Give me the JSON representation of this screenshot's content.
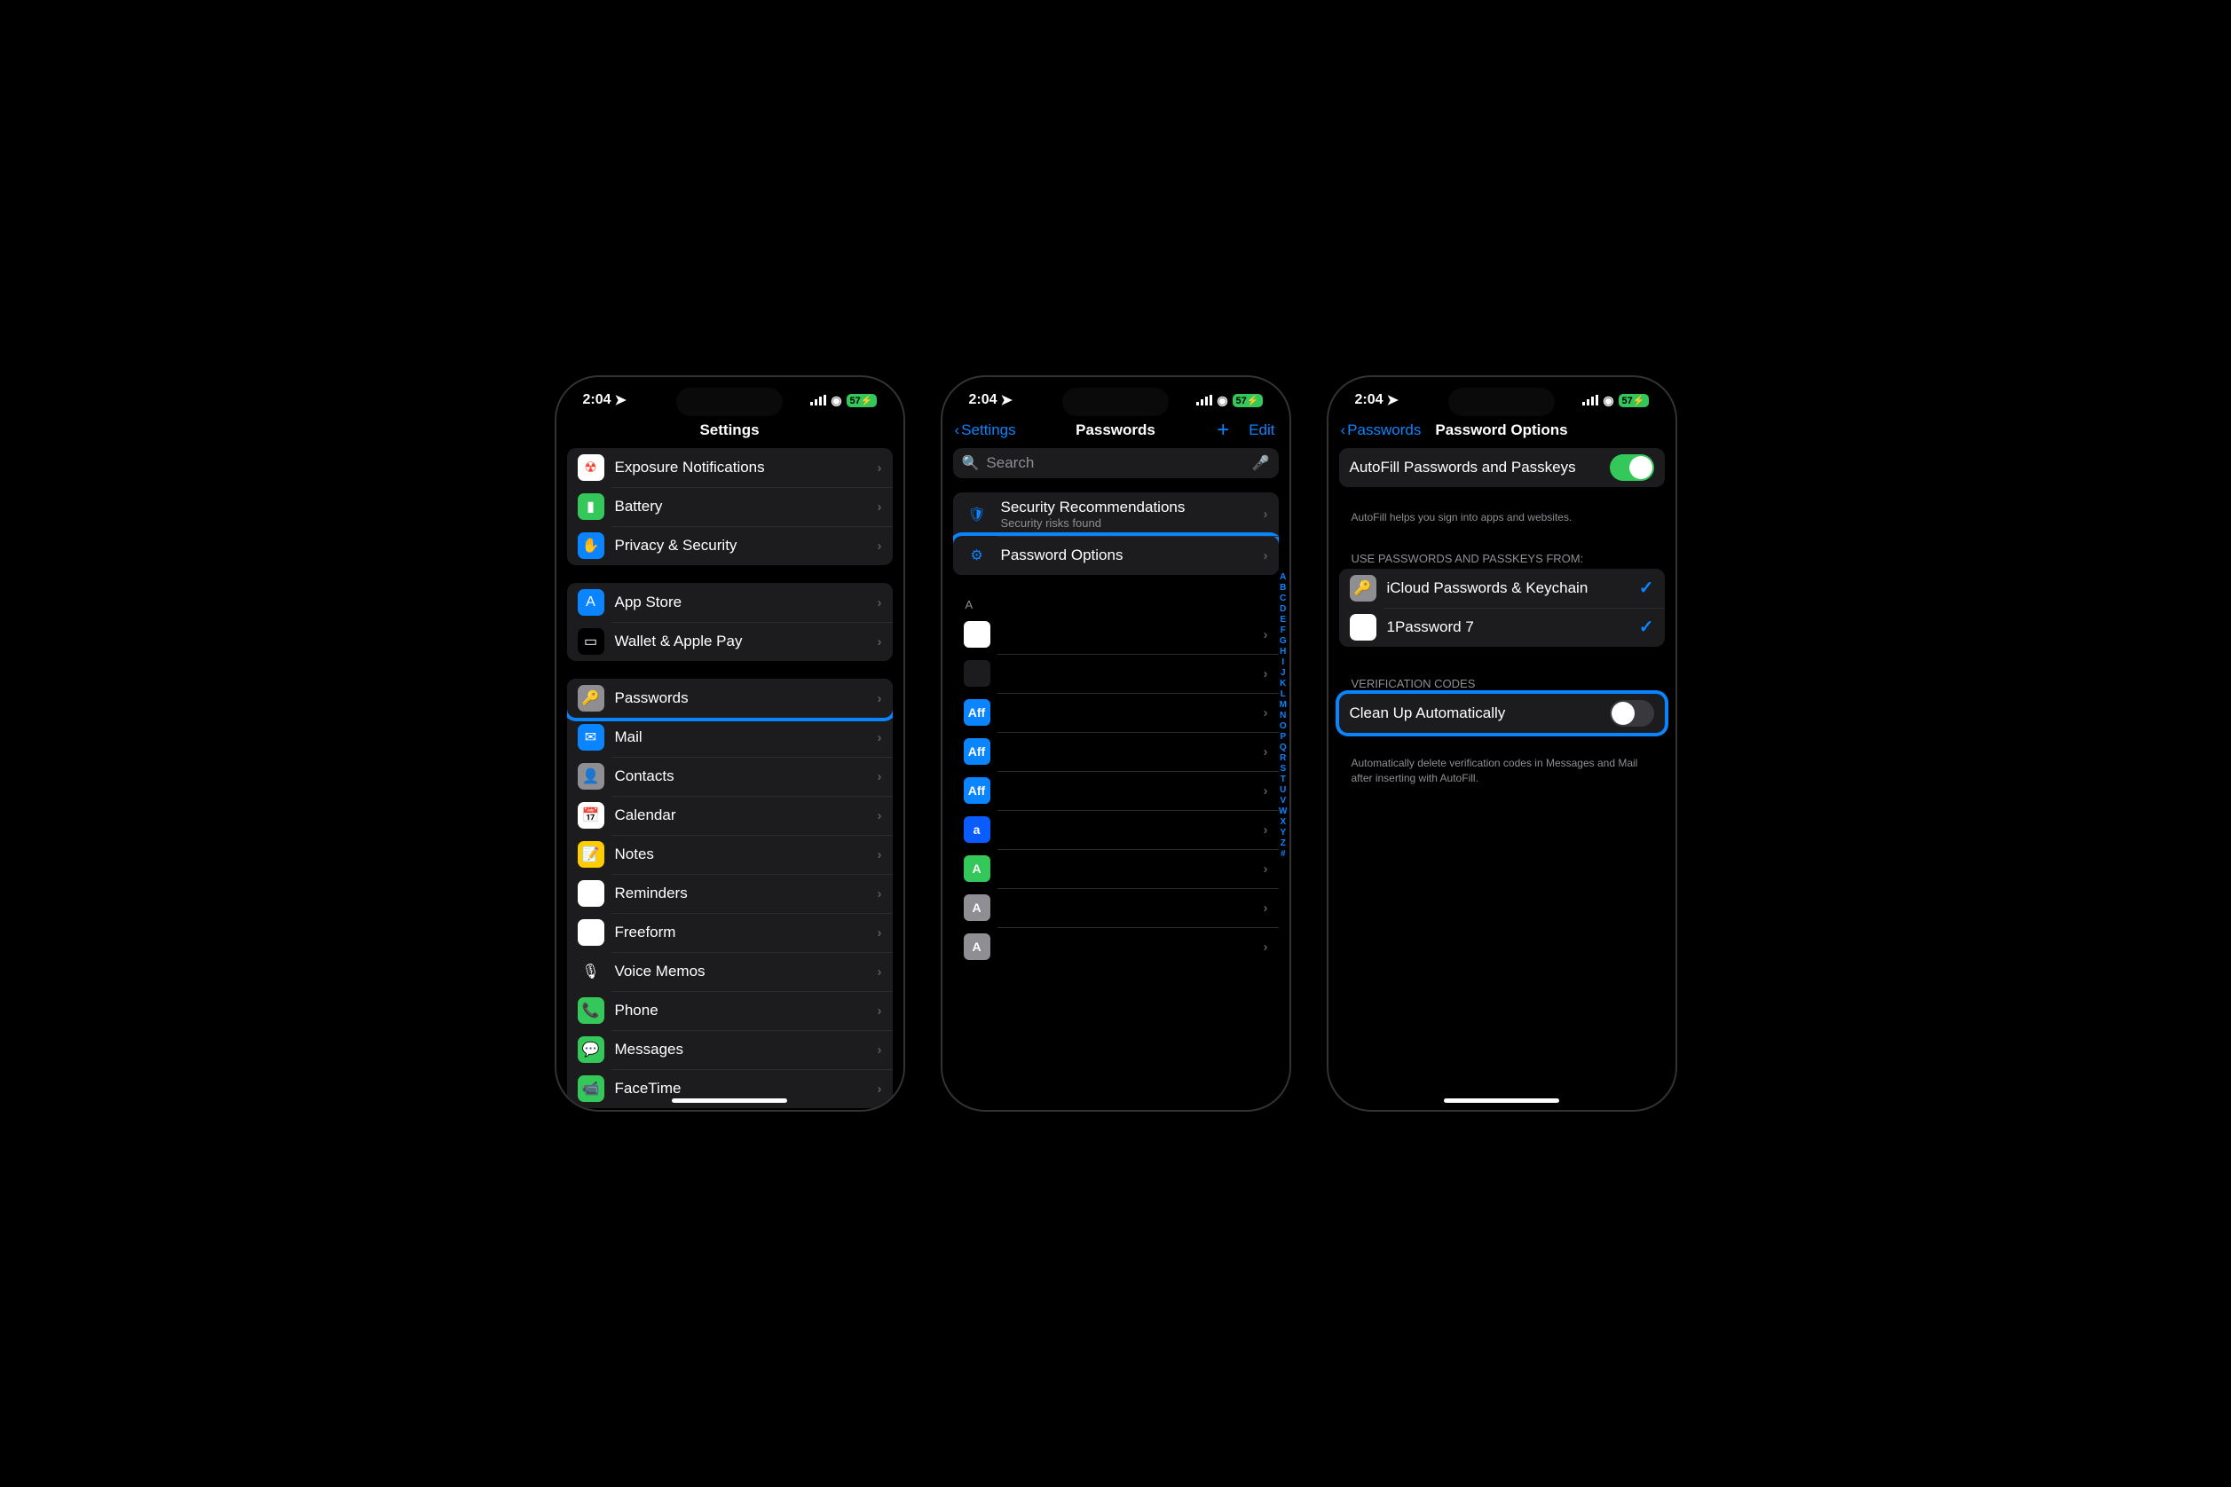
{
  "status": {
    "time": "2:04",
    "battery": "57",
    "location_on": true
  },
  "phone1": {
    "title": "Settings",
    "groups": [
      {
        "items": [
          {
            "icon": "radiation-icon",
            "bg": "#fff",
            "fg": "#ff3b30",
            "label": "Exposure Notifications"
          },
          {
            "icon": "battery-icon",
            "bg": "#34c759",
            "label": "Battery"
          },
          {
            "icon": "hand-icon",
            "bg": "#0a84ff",
            "label": "Privacy & Security"
          }
        ]
      },
      {
        "items": [
          {
            "icon": "appstore-icon",
            "bg": "#0a84ff",
            "label": "App Store"
          },
          {
            "icon": "wallet-icon",
            "bg": "#000",
            "label": "Wallet & Apple Pay"
          }
        ]
      },
      {
        "items": [
          {
            "icon": "key-icon",
            "bg": "#8e8e93",
            "label": "Passwords",
            "highlighted": true
          },
          {
            "icon": "mail-icon",
            "bg": "#0a84ff",
            "label": "Mail"
          },
          {
            "icon": "contacts-icon",
            "bg": "#8e8e93",
            "label": "Contacts"
          },
          {
            "icon": "calendar-icon",
            "bg": "#fff",
            "fg": "#ff3b30",
            "label": "Calendar"
          },
          {
            "icon": "notes-icon",
            "bg": "#ffcc00",
            "label": "Notes"
          },
          {
            "icon": "reminders-icon",
            "bg": "#fff",
            "label": "Reminders"
          },
          {
            "icon": "freeform-icon",
            "bg": "#fff",
            "label": "Freeform"
          },
          {
            "icon": "voicememos-icon",
            "bg": "#1c1c1e",
            "label": "Voice Memos"
          },
          {
            "icon": "phone-icon",
            "bg": "#34c759",
            "label": "Phone"
          },
          {
            "icon": "messages-icon",
            "bg": "#34c759",
            "label": "Messages"
          },
          {
            "icon": "facetime-icon",
            "bg": "#34c759",
            "label": "FaceTime"
          }
        ]
      }
    ]
  },
  "phone2": {
    "back": "Settings",
    "title": "Passwords",
    "edit": "Edit",
    "search_placeholder": "Search",
    "options": [
      {
        "icon": "shield-icon",
        "label": "Security Recommendations",
        "sub": "Security risks found"
      },
      {
        "icon": "sliders-icon",
        "label": "Password Options",
        "highlighted": true
      }
    ],
    "section_letter": "A",
    "password_rows": [
      {
        "bg": "#fff",
        "glyph": ""
      },
      {
        "bg": "#1c1c1e",
        "glyph": ""
      },
      {
        "bg": "#0a84ff",
        "glyph": "Aff"
      },
      {
        "bg": "#0a84ff",
        "glyph": "Aff"
      },
      {
        "bg": "#0a84ff",
        "glyph": "Aff"
      },
      {
        "bg": "#0a5cff",
        "glyph": "a"
      },
      {
        "bg": "#34c759",
        "glyph": "A"
      },
      {
        "bg": "#8e8e93",
        "glyph": "A"
      },
      {
        "bg": "#8e8e93",
        "glyph": "A"
      }
    ],
    "index": [
      "A",
      "B",
      "C",
      "D",
      "E",
      "F",
      "G",
      "H",
      "I",
      "J",
      "K",
      "L",
      "M",
      "N",
      "O",
      "P",
      "Q",
      "R",
      "S",
      "T",
      "U",
      "V",
      "W",
      "X",
      "Y",
      "Z",
      "#"
    ]
  },
  "phone3": {
    "back": "Passwords",
    "title": "Password Options",
    "autofill": {
      "label": "AutoFill Passwords and Passkeys",
      "on": true,
      "footer": "AutoFill helps you sign into apps and websites."
    },
    "providers_header": "USE PASSWORDS AND PASSKEYS FROM:",
    "providers": [
      {
        "icon": "key-icon",
        "bg": "#8e8e93",
        "label": "iCloud Passwords & Keychain",
        "checked": true
      },
      {
        "icon": "onepassword-icon",
        "bg": "#fff",
        "label": "1Password 7",
        "checked": true
      }
    ],
    "verification_header": "VERIFICATION CODES",
    "cleanup": {
      "label": "Clean Up Automatically",
      "on": false,
      "highlighted": true,
      "footer": "Automatically delete verification codes in Messages and Mail after inserting with AutoFill."
    }
  }
}
